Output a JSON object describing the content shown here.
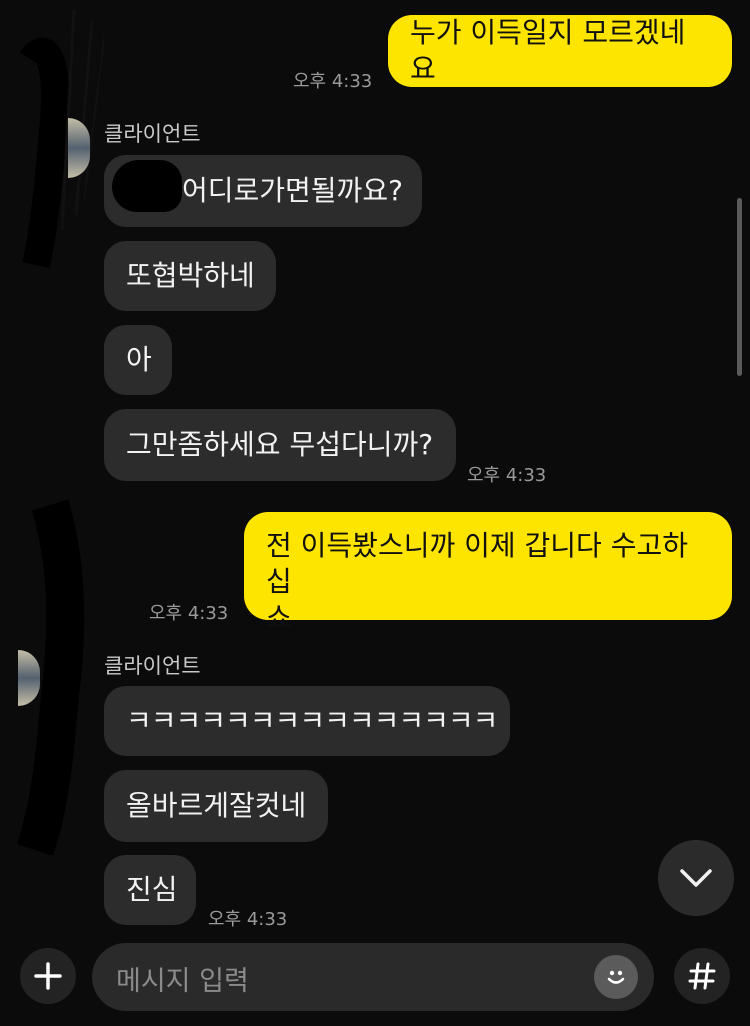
{
  "messages": {
    "m1": {
      "text": "누가 이득일지 모르겠네요",
      "time": "오후 4:33"
    },
    "sender1": "클라이언트",
    "m2": "어디로가면될까요?",
    "m3": "또협박하네",
    "m4": "아",
    "m5": {
      "text": "그만좀하세요 무섭다니까?",
      "time": "오후 4:33"
    },
    "m6": {
      "line1": "전 이득봤스니까 이제 갑니다 수고하십",
      "line2": "쇼",
      "time": "오후 4:33"
    },
    "sender2": "클라이언트",
    "m7": "ㅋㅋㅋㅋㅋㅋㅋㅋㅋㅋㅋㅋㅋㅋㅋ",
    "m8": "올바르게잘컷네",
    "m9": {
      "text": "진심",
      "time": "오후 4:33"
    }
  },
  "composer": {
    "placeholder": "메시지 입력",
    "add_icon": "plus-icon",
    "emoji_icon": "smiley-icon",
    "hashtag_icon": "hashtag-icon"
  },
  "scroll_down_icon": "chevron-down-icon",
  "colors": {
    "background": "#0b0b0b",
    "my_bubble": "#fee500",
    "their_bubble": "#2c2c2c",
    "composer": "#2a2a2a"
  }
}
